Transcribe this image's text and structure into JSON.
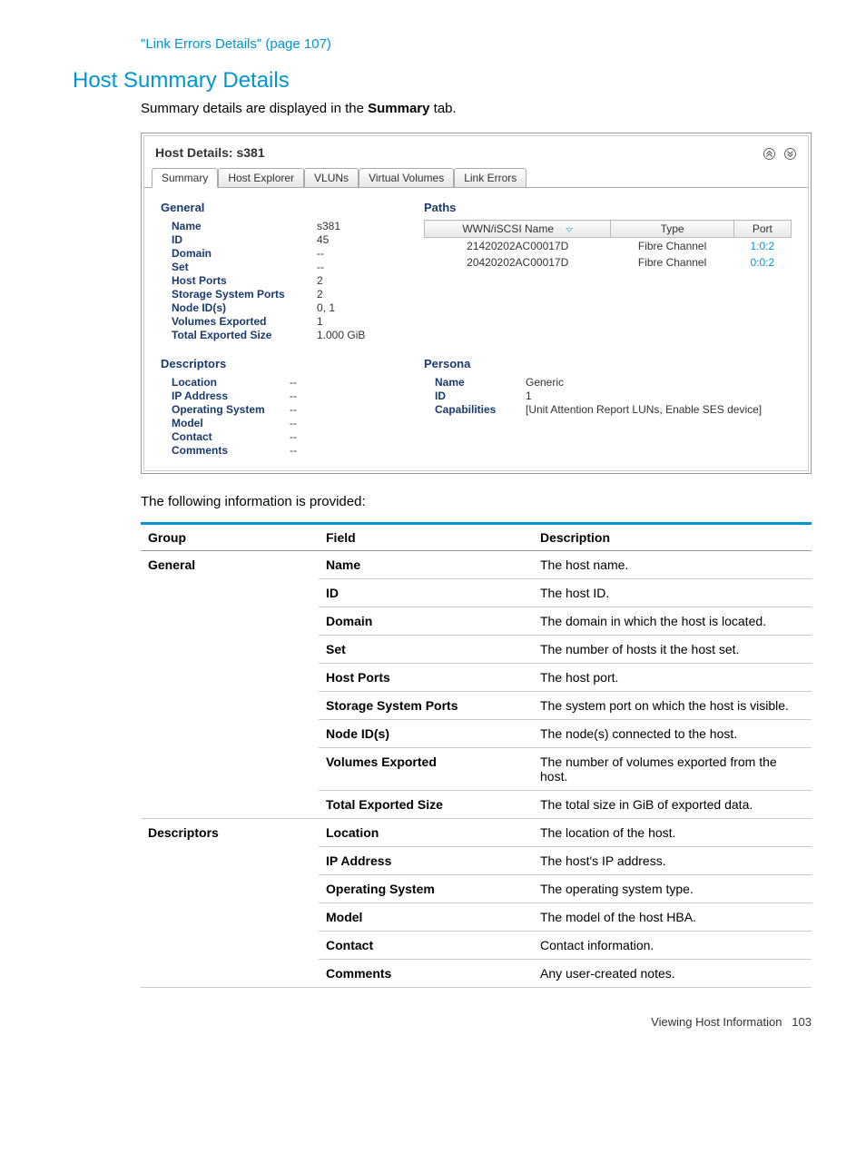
{
  "top_link": "\"Link Errors Details\" (page 107)",
  "section_title": "Host Summary Details",
  "intro": {
    "pre": "Summary details are displayed in the ",
    "bold": "Summary",
    "post": " tab."
  },
  "panel": {
    "title": "Host Details: s381",
    "tabs": [
      "Summary",
      "Host Explorer",
      "VLUNs",
      "Virtual Volumes",
      "Link Errors"
    ],
    "general": {
      "heading": "General",
      "rows": [
        {
          "k": "Name",
          "v": "s381"
        },
        {
          "k": "ID",
          "v": "45"
        },
        {
          "k": "Domain",
          "v": "--"
        },
        {
          "k": "Set",
          "v": "--"
        },
        {
          "k": "Host Ports",
          "v": "2"
        },
        {
          "k": "Storage System Ports",
          "v": "2"
        },
        {
          "k": "Node ID(s)",
          "v": "0, 1"
        },
        {
          "k": "Volumes Exported",
          "v": "1"
        },
        {
          "k": "Total Exported Size",
          "v": "1.000 GiB"
        }
      ]
    },
    "paths": {
      "heading": "Paths",
      "cols": [
        "WWN/iSCSI Name",
        "Type",
        "Port"
      ],
      "rows": [
        {
          "wwn": "21420202AC00017D",
          "type": "Fibre Channel",
          "port": "1:0:2"
        },
        {
          "wwn": "20420202AC00017D",
          "type": "Fibre Channel",
          "port": "0:0:2"
        }
      ]
    },
    "descriptors": {
      "heading": "Descriptors",
      "rows": [
        {
          "k": "Location",
          "v": "--"
        },
        {
          "k": "IP Address",
          "v": "--"
        },
        {
          "k": "Operating System",
          "v": "--"
        },
        {
          "k": "Model",
          "v": "--"
        },
        {
          "k": "Contact",
          "v": "--"
        },
        {
          "k": "Comments",
          "v": "--"
        }
      ]
    },
    "persona": {
      "heading": "Persona",
      "rows": [
        {
          "k": "Name",
          "v": "Generic"
        },
        {
          "k": "ID",
          "v": "1"
        },
        {
          "k": "Capabilities",
          "v": "[Unit Attention Report LUNs, Enable SES device]"
        }
      ]
    }
  },
  "desc_intro": "The following information is provided:",
  "table": {
    "headers": [
      "Group",
      "Field",
      "Description"
    ],
    "rows": [
      {
        "group": "General",
        "field": "Name",
        "desc": "The host name."
      },
      {
        "group": "",
        "field": "ID",
        "desc": "The host ID."
      },
      {
        "group": "",
        "field": "Domain",
        "desc": "The domain in which the host is located."
      },
      {
        "group": "",
        "field": "Set",
        "desc": "The number of hosts it the host set."
      },
      {
        "group": "",
        "field": "Host Ports",
        "desc": "The host port."
      },
      {
        "group": "",
        "field": "Storage System Ports",
        "desc": "The system port on which the host is visible."
      },
      {
        "group": "",
        "field": "Node ID(s)",
        "desc": "The node(s) connected to the host."
      },
      {
        "group": "",
        "field": "Volumes Exported",
        "desc": "The number of volumes exported from the host."
      },
      {
        "group": "",
        "field": "Total Exported Size",
        "desc": "The total size in GiB of exported data."
      },
      {
        "group": "Descriptors",
        "field": "Location",
        "desc": "The location of the host."
      },
      {
        "group": "",
        "field": "IP Address",
        "desc": "The host's IP address."
      },
      {
        "group": "",
        "field": "Operating System",
        "desc": "The operating system type."
      },
      {
        "group": "",
        "field": "Model",
        "desc": "The model of the host HBA."
      },
      {
        "group": "",
        "field": "Contact",
        "desc": "Contact information."
      },
      {
        "group": "",
        "field": "Comments",
        "desc": "Any user-created notes."
      }
    ]
  },
  "footer": {
    "text": "Viewing Host Information",
    "page": "103"
  }
}
